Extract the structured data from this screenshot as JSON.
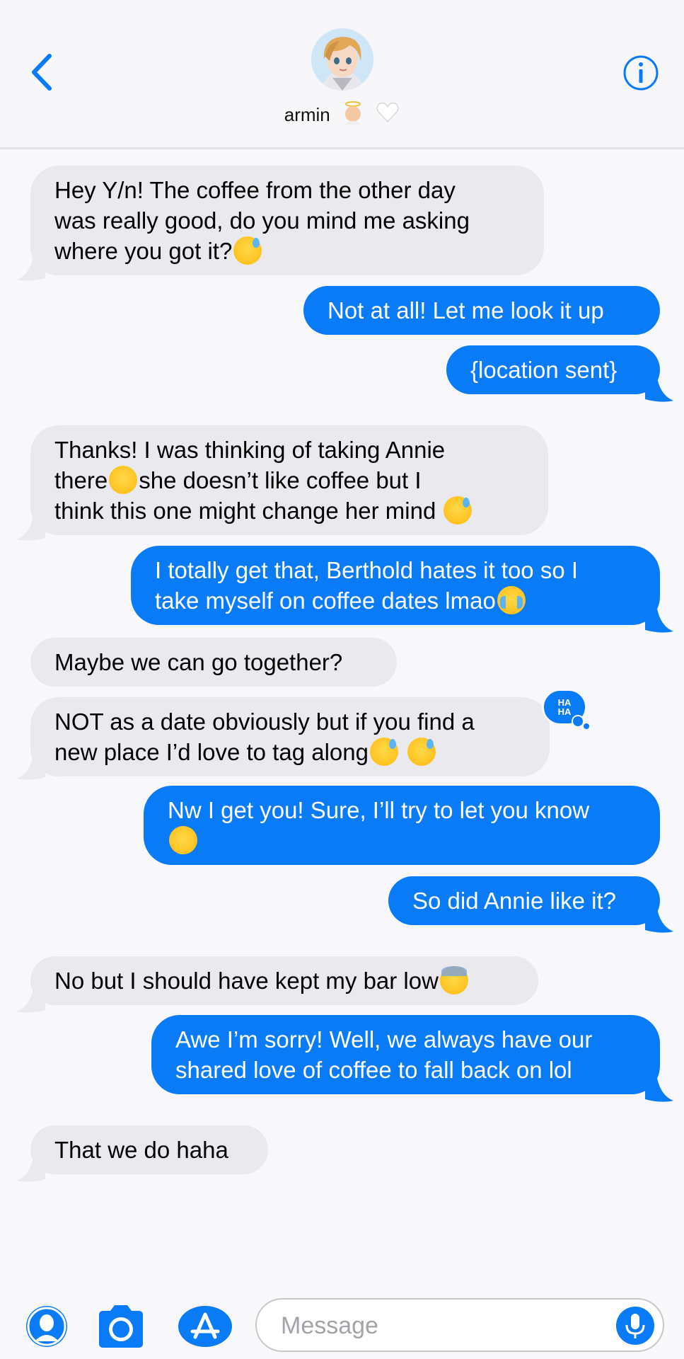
{
  "header": {
    "contact_name": "armin",
    "icons": [
      "back-chevron-icon",
      "info-icon",
      "baby-angel-emoji",
      "white-heart-emoji"
    ]
  },
  "messages": [
    {
      "dir": "in",
      "lines": [
        "Hey Y/n! The coffee from the other day",
        "was really good, do you mind me asking",
        "where you got it?"
      ],
      "emoji_after": "sweat-smile"
    },
    {
      "dir": "out",
      "text": "Not at all! Let me look it up"
    },
    {
      "dir": "out",
      "text": "{location sent}"
    },
    {
      "dir": "in",
      "line1": "Thanks! I was thinking of taking Annie",
      "line2a": "there",
      "line2b": "she doesn’t like coffee but I",
      "line3": "think this one might change her mind"
    },
    {
      "dir": "out",
      "line1": "I totally get that, Berthold hates it too so I",
      "line2": "take myself on coffee dates lmao"
    },
    {
      "dir": "in",
      "text": "Maybe we can go together?"
    },
    {
      "dir": "in",
      "line1": "NOT as a date obviously but if you find a",
      "line2": "new place I’d love to tag along",
      "reaction": "HA HA"
    },
    {
      "dir": "out",
      "line1": "Nw I get you! Sure, I’ll try to let you know"
    },
    {
      "dir": "out",
      "text": "So did Annie like it?"
    },
    {
      "dir": "in",
      "text": "No but I should have kept my bar low"
    },
    {
      "dir": "out",
      "line1": "Awe I’m sorry! Well, we always have our",
      "line2": "shared love of coffee to fall back on lol"
    },
    {
      "dir": "in",
      "text": "That we do haha"
    }
  ],
  "reaction": {
    "line1": "HA",
    "line2": "HA"
  },
  "footer": {
    "placeholder": "Message",
    "icons": [
      "memoji-icon",
      "camera-icon",
      "app-store-icon",
      "microphone-icon"
    ]
  },
  "colors": {
    "accent": "#0a7bf7",
    "incoming": "#e9e9ee",
    "background": "#f8f8fa"
  }
}
